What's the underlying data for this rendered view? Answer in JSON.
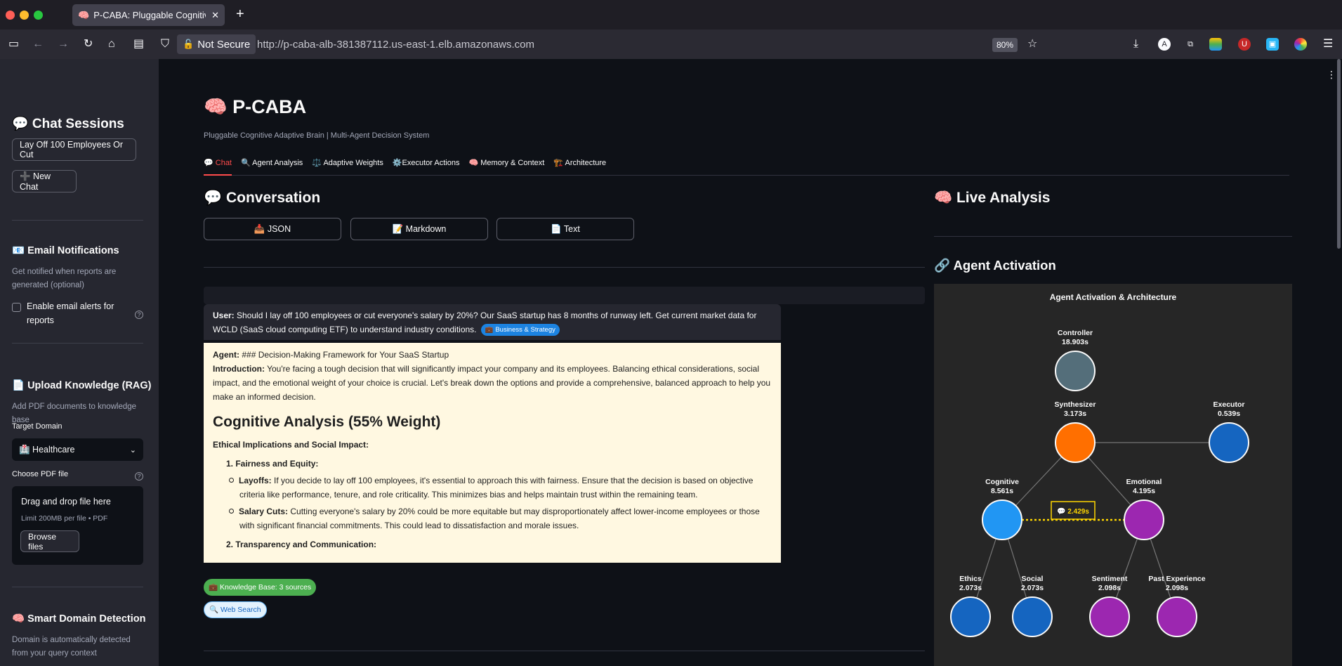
{
  "browser": {
    "tab_title": "P-CABA: Pluggable Cognitive Adaptive Brain",
    "tab_favicon": "🧠",
    "new_tab": "+",
    "close": "✕",
    "security": "Not Secure",
    "url": "http://p-caba-alb-381387112.us-east-1.elb.amazonaws.com",
    "zoom": "80%"
  },
  "sidebar": {
    "sessions_title": "💬 Chat Sessions",
    "current_session": "Lay Off 100 Employees Or Cut",
    "new_chat": "➕ New Chat",
    "email_title": "📧 Email Notifications",
    "email_desc": "Get notified when reports are generated (optional)",
    "email_checkbox": "Enable email alerts for reports",
    "upload_title": "📄 Upload Knowledge (RAG)",
    "upload_desc": "Add PDF documents to knowledge base",
    "target_domain_label": "Target Domain",
    "target_domain_value": "🏥 Healthcare",
    "choose_file_label": "Choose PDF file",
    "drop_title": "Drag and drop file here",
    "drop_limit": "Limit 200MB per file • PDF",
    "browse": "Browse files",
    "smart_title": "🧠 Smart Domain Detection",
    "smart_desc": "Domain is automatically detected from your query context"
  },
  "main": {
    "title": "🧠 P-CABA",
    "subtitle": "Pluggable Cognitive Adaptive Brain | Multi-Agent Decision System",
    "tabs": [
      {
        "label": "💬 Chat"
      },
      {
        "label": "🔍 Agent Analysis"
      },
      {
        "label": "⚖️ Adaptive Weights"
      },
      {
        "label": "⚙️Executor Actions"
      },
      {
        "label": "🧠 Memory & Context"
      },
      {
        "label": "🏗️ Architecture"
      }
    ],
    "conversation_title": "💬 Conversation",
    "export_json": "📥 JSON",
    "export_md": "📝 Markdown",
    "export_text": "📄 Text",
    "user_label": "User:",
    "user_text": "Should I lay off 100 employees or cut everyone's salary by 20%? Our SaaS startup has 8 months of runway left. Get current market data for WCLD (SaaS cloud computing ETF) to understand industry conditions.",
    "user_tag": "💼 Business & Strategy",
    "agent_label": "Agent:",
    "agent_heading_raw": "### Decision-Making Framework for Your SaaS Startup",
    "intro_label": "Introduction:",
    "intro_text": "You're facing a tough decision that will significantly impact your company and its employees. Balancing ethical considerations, social impact, and the emotional weight of your choice is crucial. Let's break down the options and provide a comprehensive, balanced approach to help you make an informed decision.",
    "cog_heading": "Cognitive Analysis (55% Weight)",
    "ethical_heading": "Ethical Implications and Social Impact:",
    "item1": "1.  Fairness and Equity:",
    "layoffs_label": "Layoffs:",
    "layoffs_text": "If you decide to lay off 100 employees, it's essential to approach this with fairness. Ensure that the decision is based on objective criteria like performance, tenure, and role criticality. This minimizes bias and helps maintain trust within the remaining team.",
    "salary_label": "Salary Cuts:",
    "salary_text": "Cutting everyone's salary by 20% could be more equitable but may disproportionately affect lower-income employees or those with significant financial commitments. This could lead to dissatisfaction and morale issues.",
    "item2": "2.  Transparency and Communication:",
    "kb_pill": "💼 Knowledge Base: 3 sources",
    "web_pill": "🔍 Web Search",
    "live_title": "🧠 Live Analysis",
    "activation_title": "🔗 Agent Activation"
  },
  "chart_data": {
    "type": "network",
    "title": "Agent Activation & Architecture",
    "nodes": [
      {
        "id": "controller",
        "name": "Controller",
        "time": "18.903s",
        "color": "#546e7a"
      },
      {
        "id": "synth",
        "name": "Synthesizer",
        "time": "3.173s",
        "color": "#ff6f00"
      },
      {
        "id": "exec",
        "name": "Executor",
        "time": "0.539s",
        "color": "#1565c0"
      },
      {
        "id": "cog",
        "name": "Cognitive",
        "time": "8.561s",
        "color": "#2196f3"
      },
      {
        "id": "emo",
        "name": "Emotional",
        "time": "4.195s",
        "color": "#9c27b0"
      },
      {
        "id": "ethics",
        "name": "Ethics",
        "time": "2.073s",
        "color": "#1565c0"
      },
      {
        "id": "social",
        "name": "Social",
        "time": "2.073s",
        "color": "#1565c0"
      },
      {
        "id": "sent",
        "name": "Sentiment",
        "time": "2.098s",
        "color": "#9c27b0"
      },
      {
        "id": "past",
        "name": "Past Experience",
        "time": "2.098s",
        "color": "#9c27b0"
      }
    ],
    "edges": [
      [
        "synth",
        "exec"
      ],
      [
        "synth",
        "cog"
      ],
      [
        "synth",
        "emo"
      ],
      [
        "cog",
        "ethics"
      ],
      [
        "cog",
        "social"
      ],
      [
        "emo",
        "sent"
      ],
      [
        "emo",
        "past"
      ]
    ],
    "dialog_edge": {
      "from": "cog",
      "to": "emo",
      "label": "💬 2.429s",
      "color": "#ffd600"
    }
  }
}
